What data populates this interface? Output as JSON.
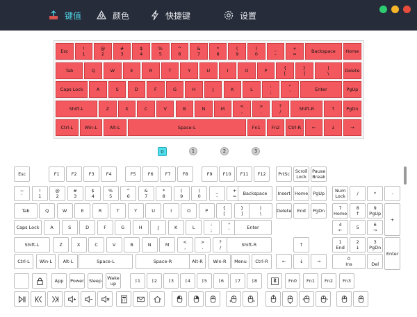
{
  "tabs": [
    {
      "id": "keys",
      "label": "键值",
      "icon": "keyboard-icon",
      "active": true
    },
    {
      "id": "color",
      "label": "颜色",
      "icon": "color-wheel-icon",
      "active": false
    },
    {
      "id": "hotkey",
      "label": "快捷键",
      "icon": "lightning-icon",
      "active": false
    },
    {
      "id": "settings",
      "label": "设置",
      "icon": "gear-icon",
      "active": false
    }
  ],
  "window_controls": {
    "colors": [
      "#2ecc71",
      "#f5b52b",
      "#e74c3c"
    ]
  },
  "layers": [
    "0",
    "1",
    "2",
    "3"
  ],
  "active_layer": "0",
  "colors": {
    "accent": "#4fd3e6",
    "key_red": "#f3585e",
    "topbar": "#262c39"
  },
  "kb60_rows": [
    [
      [
        "Esc"
      ],
      [
        "!",
        "1"
      ],
      [
        "@",
        "2"
      ],
      [
        "#",
        "3"
      ],
      [
        "$",
        "4"
      ],
      [
        "%",
        "5"
      ],
      [
        "^",
        "6"
      ],
      [
        "&",
        "7"
      ],
      [
        "*",
        "8"
      ],
      [
        "(",
        "9"
      ],
      [
        ")",
        "0"
      ],
      [
        "_",
        "-"
      ],
      [
        "+",
        "="
      ],
      [
        "Backspace"
      ],
      [
        "Home"
      ]
    ],
    [
      [
        "Tab"
      ],
      [
        "Q"
      ],
      [
        "W"
      ],
      [
        "E"
      ],
      [
        "R"
      ],
      [
        "T"
      ],
      [
        "Y"
      ],
      [
        "U"
      ],
      [
        "I"
      ],
      [
        "O"
      ],
      [
        "P"
      ],
      [
        "{",
        "["
      ],
      [
        "}",
        "]"
      ],
      [
        "|",
        "\\"
      ],
      [
        "Delete"
      ]
    ],
    [
      [
        "Caps Lock"
      ],
      [
        "A"
      ],
      [
        "S"
      ],
      [
        "D"
      ],
      [
        "F"
      ],
      [
        "G"
      ],
      [
        "H"
      ],
      [
        "J"
      ],
      [
        "K"
      ],
      [
        "L"
      ],
      [
        ":",
        ";"
      ],
      [
        "\"",
        "'"
      ],
      [
        "Enter"
      ],
      [
        "PgUp"
      ]
    ],
    [
      [
        "Shift-L"
      ],
      [
        "Z"
      ],
      [
        "X"
      ],
      [
        "C"
      ],
      [
        "V"
      ],
      [
        "B"
      ],
      [
        "N"
      ],
      [
        "M"
      ],
      [
        "<",
        ","
      ],
      [
        ">",
        "."
      ],
      [
        "?",
        "/"
      ],
      [
        "Shift-R"
      ],
      [
        "↑"
      ],
      [
        "PgDn"
      ]
    ],
    [
      [
        "Ctrl-L"
      ],
      [
        "Win-L"
      ],
      [
        "Alt-L"
      ],
      [
        "Space-L"
      ],
      [
        "Fn1"
      ],
      [
        "Fn2"
      ],
      [
        "Ctrl-R"
      ],
      [
        "←"
      ],
      [
        "↓"
      ],
      [
        "→"
      ]
    ]
  ],
  "kb_rows": [
    [
      [
        "Esc"
      ],
      [
        "F1"
      ],
      [
        "F2"
      ],
      [
        "F3"
      ],
      [
        "F4"
      ],
      [
        "F5"
      ],
      [
        "F6"
      ],
      [
        "F7"
      ],
      [
        "F8"
      ],
      [
        "F9"
      ],
      [
        "F10"
      ],
      [
        "F11"
      ],
      [
        "F12"
      ],
      [
        "PrtSc"
      ],
      [
        "Scroll",
        "Lock"
      ],
      [
        "Pause",
        "Break"
      ]
    ],
    [
      [
        "~",
        "`"
      ],
      [
        "!",
        "1"
      ],
      [
        "@",
        "2"
      ],
      [
        "#",
        "3"
      ],
      [
        "$",
        "4"
      ],
      [
        "%",
        "5"
      ],
      [
        "^",
        "6"
      ],
      [
        "&",
        "7"
      ],
      [
        "*",
        "8"
      ],
      [
        "(",
        "9"
      ],
      [
        ")",
        "0"
      ],
      [
        "_",
        "-"
      ],
      [
        "+",
        "="
      ],
      [
        "Backspace"
      ],
      [
        "Insert"
      ],
      [
        "Home"
      ],
      [
        "PgUp"
      ],
      [
        "Num",
        "Lock"
      ],
      [
        "/"
      ],
      [
        "*"
      ],
      [
        "-"
      ]
    ],
    [
      [
        "Tab"
      ],
      [
        "Q"
      ],
      [
        "W"
      ],
      [
        "E"
      ],
      [
        "R"
      ],
      [
        "T"
      ],
      [
        "Y"
      ],
      [
        "U"
      ],
      [
        "I"
      ],
      [
        "O"
      ],
      [
        "P"
      ],
      [
        "{",
        "["
      ],
      [
        "}",
        "]"
      ],
      [
        "|",
        "\\"
      ],
      [
        "Delete"
      ],
      [
        "End"
      ],
      [
        "PgDn"
      ],
      [
        "7",
        "Home"
      ],
      [
        "8",
        "↑"
      ],
      [
        "9",
        "PgUp"
      ],
      [
        "+"
      ]
    ],
    [
      [
        "Caps Lock"
      ],
      [
        "A"
      ],
      [
        "S"
      ],
      [
        "D"
      ],
      [
        "F"
      ],
      [
        "G"
      ],
      [
        "H"
      ],
      [
        "J"
      ],
      [
        "K"
      ],
      [
        "L"
      ],
      [
        ":",
        ";"
      ],
      [
        "\"",
        "'"
      ],
      [
        "Enter"
      ],
      [
        "4",
        "←"
      ],
      [
        "5"
      ],
      [
        "6",
        "→"
      ]
    ],
    [
      [
        "Shift-L"
      ],
      [
        "Z"
      ],
      [
        "X"
      ],
      [
        "C"
      ],
      [
        "V"
      ],
      [
        "B"
      ],
      [
        "N"
      ],
      [
        "M"
      ],
      [
        "<",
        ","
      ],
      [
        ">",
        "."
      ],
      [
        "?",
        "/"
      ],
      [
        "Shift-R"
      ],
      [
        "↑"
      ],
      [
        "1",
        "End"
      ],
      [
        "2",
        "↓"
      ],
      [
        "3",
        "PgDn"
      ],
      [
        "Enter"
      ]
    ],
    [
      [
        "Ctrl-L"
      ],
      [
        "Win-L"
      ],
      [
        "Alt-L"
      ],
      [
        "Space-L"
      ],
      [
        "Space-R"
      ],
      [
        "Alt-R"
      ],
      [
        "Win-R"
      ],
      [
        "Menu"
      ],
      [
        "Ctrl-R"
      ],
      [
        "←"
      ],
      [
        "↓"
      ],
      [
        "→"
      ],
      [
        "0",
        "Ins"
      ],
      [
        ".",
        "Del"
      ]
    ]
  ],
  "special_row": [
    {
      "icon": "blank-key"
    },
    {
      "icon": "lock-icon"
    },
    {
      "label": "App"
    },
    {
      "label": "Power"
    },
    {
      "label": "Sleep"
    },
    {
      "label": "Wake\nup"
    },
    {
      "label": "ᛒ1"
    },
    {
      "label": "ᛒ2"
    },
    {
      "label": "ᛒ3"
    },
    {
      "label": "ᛒ4"
    },
    {
      "label": "ᛒ5"
    },
    {
      "label": "ᛒ6"
    },
    {
      "label": "ᛒ7"
    },
    {
      "label": "ᛒ8"
    },
    {
      "icon": "bluetooth-pair-icon"
    },
    {
      "label": "Fn0"
    },
    {
      "label": "Fn1"
    },
    {
      "label": "Fn2"
    },
    {
      "label": "Fn3"
    }
  ],
  "media_row": [
    {
      "icon": "play-pause-icon"
    },
    {
      "icon": "previous-track-icon"
    },
    {
      "icon": "next-track-icon"
    },
    {
      "icon": "volume-up-icon"
    },
    {
      "icon": "volume-down-icon"
    },
    {
      "icon": "mute-icon"
    },
    {
      "icon": "calculator-icon"
    },
    {
      "icon": "mail-icon"
    },
    {
      "icon": "home-icon"
    },
    {
      "icon": "mouse-left-click-icon"
    },
    {
      "icon": "mouse-right-click-icon"
    },
    {
      "icon": "mouse-middle-click-icon"
    },
    {
      "icon": "mouse-back-icon"
    },
    {
      "icon": "mouse-forward-icon"
    },
    {
      "icon": "mouse-move-up-icon"
    },
    {
      "icon": "mouse-move-down-icon"
    },
    {
      "icon": "mouse-move-left-icon"
    },
    {
      "icon": "mouse-move-right-icon"
    },
    {
      "icon": "mouse-scroll-up-icon"
    },
    {
      "icon": "mouse-scroll-down-icon"
    }
  ]
}
